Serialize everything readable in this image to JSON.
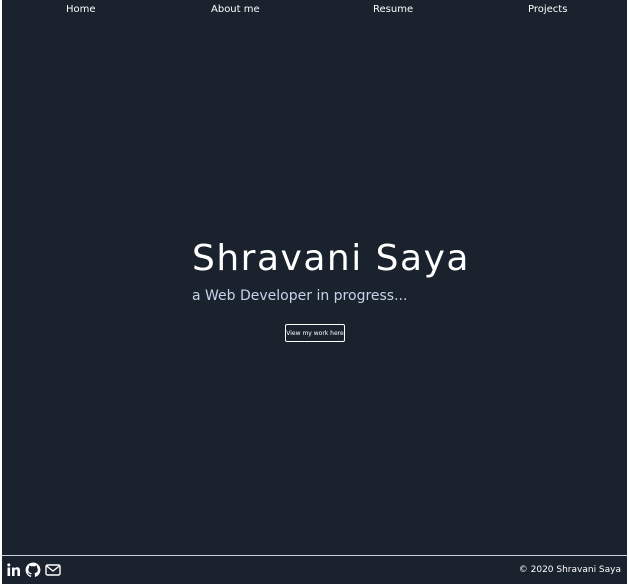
{
  "nav": {
    "items": [
      {
        "label": "Home"
      },
      {
        "label": "About me"
      },
      {
        "label": "Resume"
      },
      {
        "label": "Projects"
      }
    ]
  },
  "hero": {
    "title": "Shravani Saya",
    "subtitle": "a Web Developer in progress...",
    "cta_label": "View my work here"
  },
  "footer": {
    "social_icons": [
      "linkedin-icon",
      "github-icon",
      "mail-icon"
    ],
    "copyright": "© 2020 Shravani Saya"
  },
  "colors": {
    "background": "#1a222d",
    "text": "#ffffff",
    "subtitle": "#c6d3ea",
    "divider": "#c9d1dd"
  }
}
